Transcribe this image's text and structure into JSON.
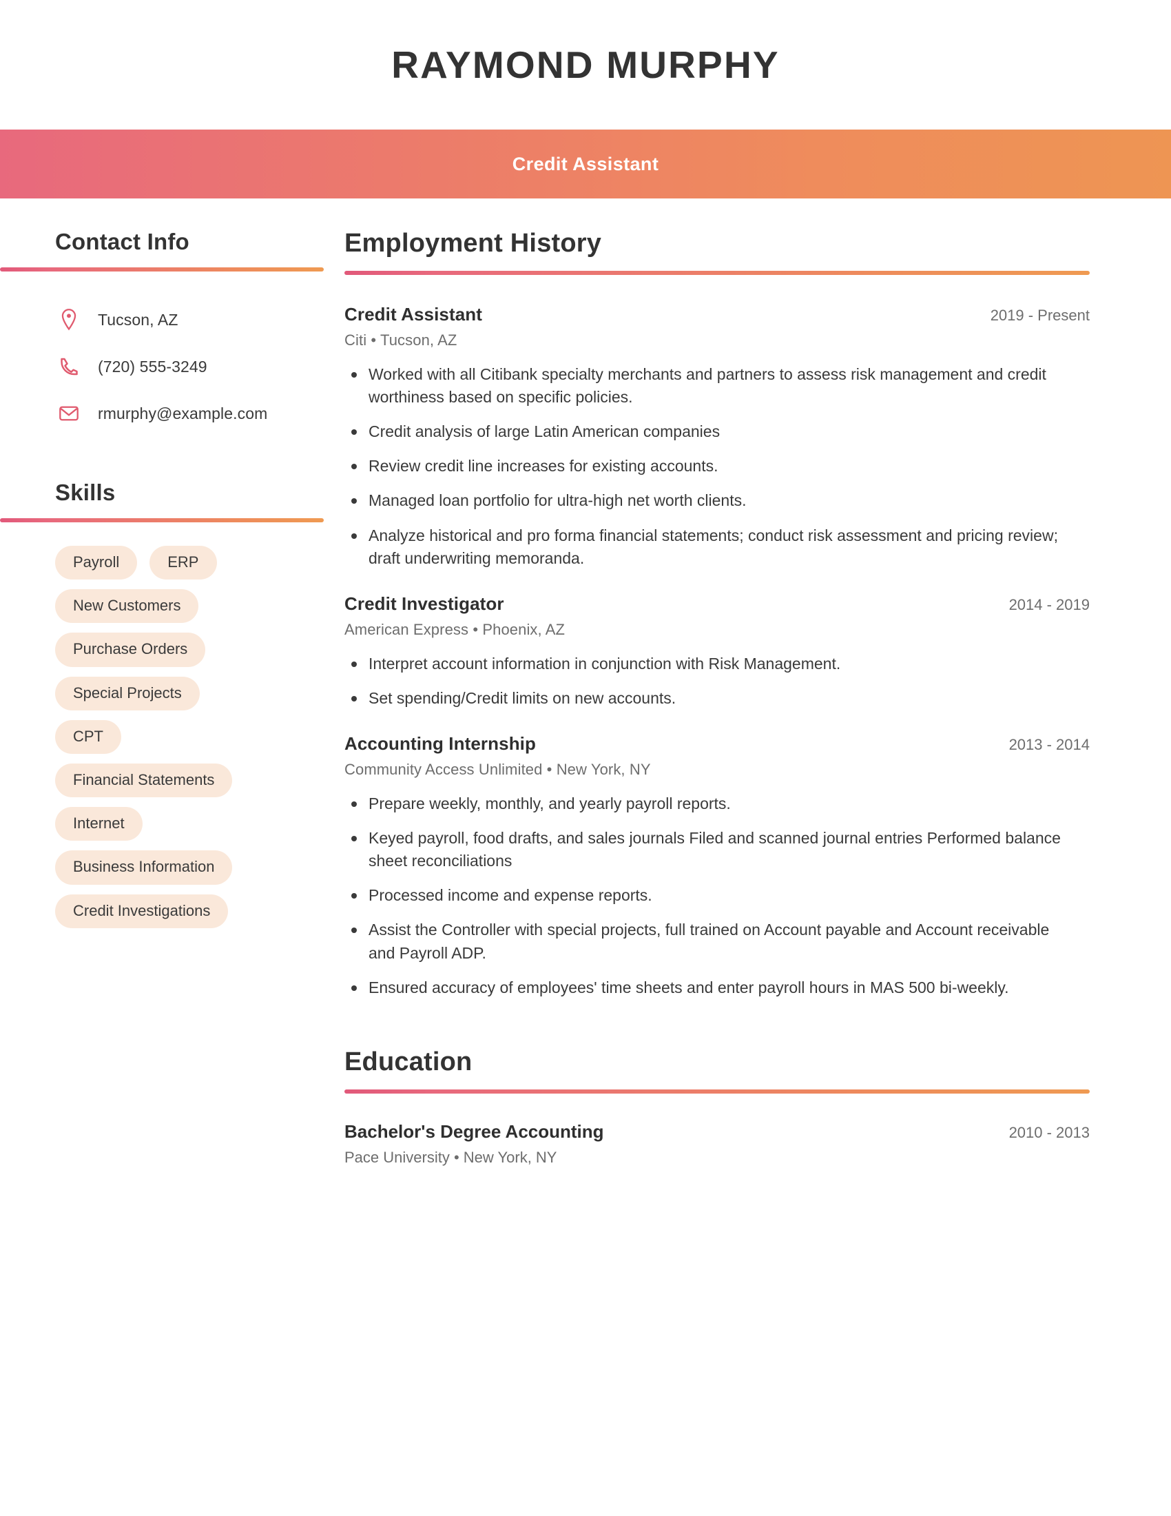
{
  "theme": {
    "gradient_start": "#e8697d",
    "gradient_end": "#ee9553",
    "icon_color": "#e05a6e",
    "pill_background": "#fae8da",
    "heading_color": "#333333",
    "muted_text": "#6d6d6d"
  },
  "header": {
    "name": "RAYMOND MURPHY",
    "job_title": "Credit Assistant"
  },
  "sidebar": {
    "contact": {
      "heading": "Contact Info",
      "items": [
        {
          "icon": "location-pin-icon",
          "value": "Tucson, AZ"
        },
        {
          "icon": "phone-icon",
          "value": "(720) 555-3249"
        },
        {
          "icon": "envelope-icon",
          "value": "rmurphy@example.com"
        }
      ]
    },
    "skills": {
      "heading": "Skills",
      "items": [
        "Payroll",
        "ERP",
        "New Customers",
        "Purchase Orders",
        "Special Projects",
        "CPT",
        "Financial Statements",
        "Internet",
        "Business Information",
        "Credit Investigations"
      ]
    }
  },
  "main": {
    "employment": {
      "heading": "Employment History",
      "jobs": [
        {
          "title": "Credit Assistant",
          "dates": "2019 - Present",
          "company": "Citi",
          "location": "Tucson, AZ",
          "subtitle": "Citi  •  Tucson, AZ",
          "bullets": [
            "Worked with all Citibank specialty merchants and partners to assess risk management and credit worthiness based on specific policies.",
            "Credit analysis of large Latin American companies",
            "Review credit line increases for existing accounts.",
            "Managed loan portfolio for ultra-high net worth clients.",
            "Analyze historical and pro forma financial statements; conduct risk assessment and pricing review; draft underwriting memoranda."
          ]
        },
        {
          "title": "Credit Investigator",
          "dates": "2014 - 2019",
          "company": "American Express",
          "location": "Phoenix, AZ",
          "subtitle": "American Express  •  Phoenix, AZ",
          "bullets": [
            "Interpret account information in conjunction with Risk Management.",
            "Set spending/Credit limits on new accounts."
          ]
        },
        {
          "title": "Accounting Internship",
          "dates": "2013 - 2014",
          "company": "Community Access Unlimited",
          "location": "New York, NY",
          "subtitle": "Community Access Unlimited  •  New York, NY",
          "bullets": [
            "Prepare weekly, monthly, and yearly payroll reports.",
            "Keyed payroll, food drafts, and sales journals Filed and scanned journal entries Performed balance sheet reconciliations",
            "Processed income and expense reports.",
            "Assist the Controller with special projects, full trained on Account payable and Account receivable and Payroll ADP.",
            "Ensured accuracy of employees' time sheets and enter payroll hours in MAS 500 bi-weekly."
          ]
        }
      ]
    },
    "education": {
      "heading": "Education",
      "items": [
        {
          "degree": "Bachelor's Degree Accounting",
          "dates": "2010 - 2013",
          "school": "Pace University",
          "location": "New York, NY",
          "subtitle": "Pace University  •  New York, NY"
        }
      ]
    }
  }
}
